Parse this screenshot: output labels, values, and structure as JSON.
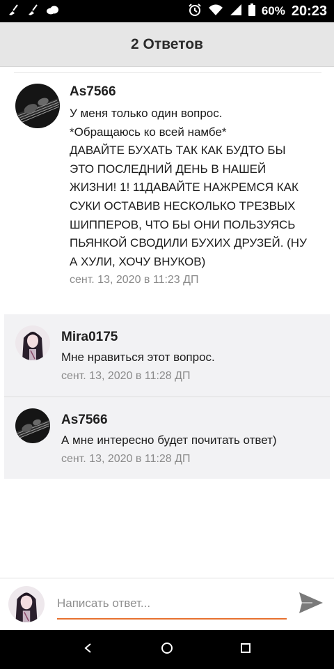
{
  "status_bar": {
    "battery": "60%",
    "time": "20:23",
    "icons": [
      "broom-icon",
      "broom-icon",
      "cloud-icon",
      "alarm-icon",
      "wifi-icon",
      "signal-icon",
      "battery-icon"
    ]
  },
  "header": {
    "title": "2 Ответов"
  },
  "main_comment": {
    "username": "As7566",
    "lines": [
      "У меня только один вопрос.",
      "*Обращаюсь ко всей намбе*",
      "ДАВАЙТЕ БУХАТЬ ТАК КАК БУДТО БЫ ЭТО ПОСЛЕДНИЙ ДЕНЬ В НАШЕЙ ЖИЗНИ! 1! 11ДАВАЙТЕ НАЖРЕМСЯ КАК СУКИ ОСТАВИВ НЕСКОЛЬКО ТРЕЗВЫХ ШИППЕРОВ, ЧТО БЫ ОНИ ПОЛЬЗУЯСЬ ПЬЯНКОЙ СВОДИЛИ БУХИХ ДРУЗЕЙ. (НУ А ХУЛИ, ХОЧУ ВНУКОВ)"
    ],
    "timestamp": "сент. 13, 2020 в 11:23 ДП"
  },
  "replies": [
    {
      "username": "Mira0175",
      "text": "Мне нравиться этот вопрос.",
      "timestamp": "сент. 13, 2020 в 11:28 ДП"
    },
    {
      "username": "As7566",
      "text": "А мне интересно будет почитать ответ)",
      "timestamp": "сент. 13, 2020 в 11:28 ДП"
    }
  ],
  "composer": {
    "placeholder": "Написать ответ...",
    "send_icon": "send-icon"
  },
  "colors": {
    "accent": "#e6702e",
    "header_bg": "#e6e6e6",
    "reply_bg": "#f2f2f4"
  },
  "nav_bar": {
    "icons": [
      "back-icon",
      "home-icon",
      "recents-icon"
    ]
  }
}
